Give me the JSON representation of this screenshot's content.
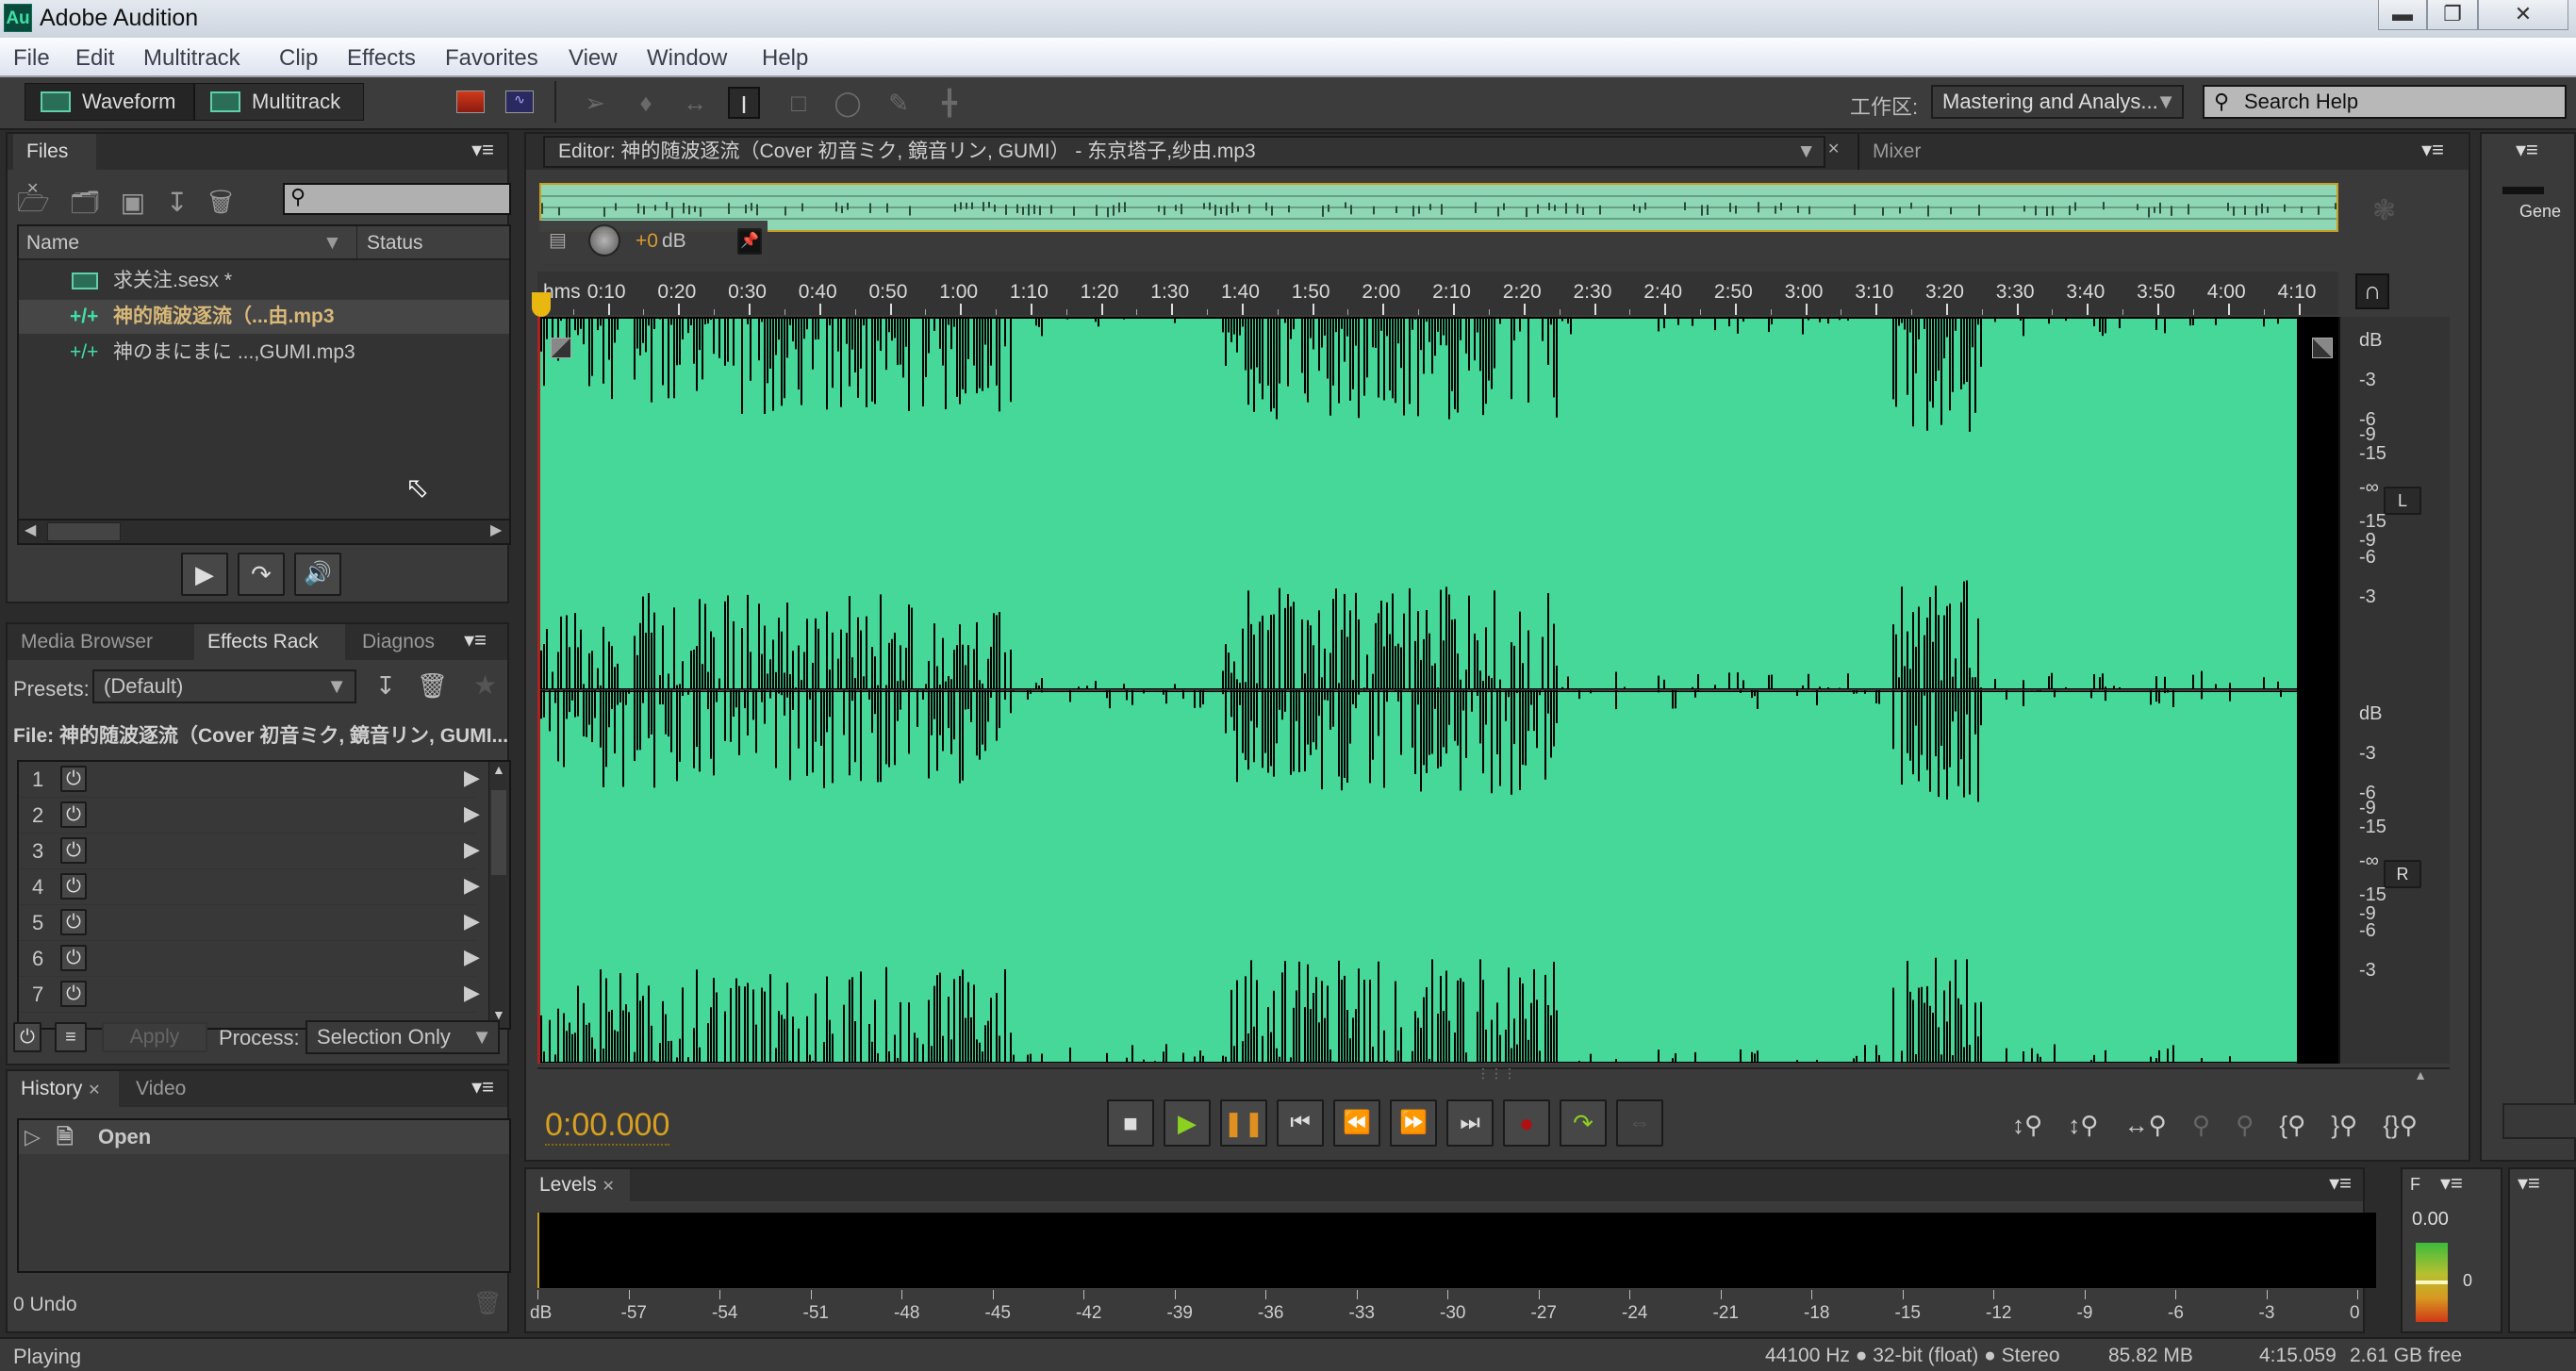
{
  "window": {
    "app_icon": "Au",
    "title": "Adobe Audition",
    "controls": [
      "minimize",
      "restore",
      "close"
    ]
  },
  "menu": [
    "File",
    "Edit",
    "Multitrack",
    "Clip",
    "Effects",
    "Favorites",
    "View",
    "Window",
    "Help"
  ],
  "toolbar": {
    "waveform_label": "Waveform",
    "multitrack_label": "Multitrack",
    "workspace_label": "工作区:",
    "workspace_value": "Mastering and Analys...",
    "search_placeholder": "Search Help"
  },
  "files": {
    "tab": "Files",
    "columns": [
      "Name",
      "Status"
    ],
    "items": [
      {
        "name": "求关注.sesx *",
        "type": "session",
        "selected": false
      },
      {
        "name": "神的随波逐流（...由.mp3",
        "type": "audio",
        "selected": true
      },
      {
        "name": "神のまにまに ...,GUMI.mp3",
        "type": "audio",
        "selected": false
      }
    ]
  },
  "effects_rack": {
    "tabs": [
      "Media Browser",
      "Effects Rack",
      "Diagnos"
    ],
    "active_tab": "Effects Rack",
    "presets_label": "Presets:",
    "presets_value": "(Default)",
    "file_label": "File: 神的随波逐流（Cover 初音ミク, 鏡音リン, GUMI...",
    "slots": [
      "1",
      "2",
      "3",
      "4",
      "5",
      "6",
      "7"
    ],
    "apply_label": "Apply",
    "process_label": "Process:",
    "process_value": "Selection Only"
  },
  "history": {
    "tabs": [
      "History",
      "Video"
    ],
    "items": [
      {
        "label": "Open"
      }
    ],
    "undo_count": "0 Undo"
  },
  "editor": {
    "tab_label": "Editor: 神的随波逐流（Cover 初音ミク, 鏡音リン, GUMI） - 东京塔子,纱由.mp3",
    "mixer_tab": "Mixer",
    "gain": "+0",
    "gain_unit": "dB",
    "ruler_unit": "hms",
    "ruler_ticks": [
      "0:10",
      "0:20",
      "0:30",
      "0:40",
      "0:50",
      "1:00",
      "1:10",
      "1:20",
      "1:30",
      "1:40",
      "1:50",
      "2:00",
      "2:10",
      "2:20",
      "2:30",
      "2:40",
      "2:50",
      "3:00",
      "3:10",
      "3:20",
      "3:30",
      "3:40",
      "3:50",
      "4:00",
      "4:10"
    ],
    "db_scale_top": [
      "dB",
      "-3",
      "-6",
      "-9",
      "-15",
      "-∞",
      "-15",
      "-9",
      "-6",
      "-3"
    ],
    "db_scale_bottom": [
      "dB",
      "-3",
      "-6",
      "-9",
      "-15",
      "-∞",
      "-15",
      "-9",
      "-6",
      "-3"
    ],
    "channel_left": "L",
    "channel_right": "R",
    "time_display": "0:00.000",
    "waveform_color": "#45d898"
  },
  "levels": {
    "tab": "Levels",
    "scale": [
      "dB",
      "-57",
      "-54",
      "-51",
      "-48",
      "-45",
      "-42",
      "-39",
      "-36",
      "-33",
      "-30",
      "-27",
      "-24",
      "-21",
      "-18",
      "-15",
      "-12",
      "-9",
      "-6",
      "-3",
      "0"
    ]
  },
  "side_panel": {
    "label": "Gene",
    "meter_value": "0.00",
    "meter_tick": "0",
    "tab_char": "F"
  },
  "status": {
    "state": "Playing",
    "format": "44100 Hz ● 32-bit (float) ● Stereo",
    "size": "85.82 MB",
    "duration": "4:15.059",
    "free": "2.61 GB free"
  }
}
